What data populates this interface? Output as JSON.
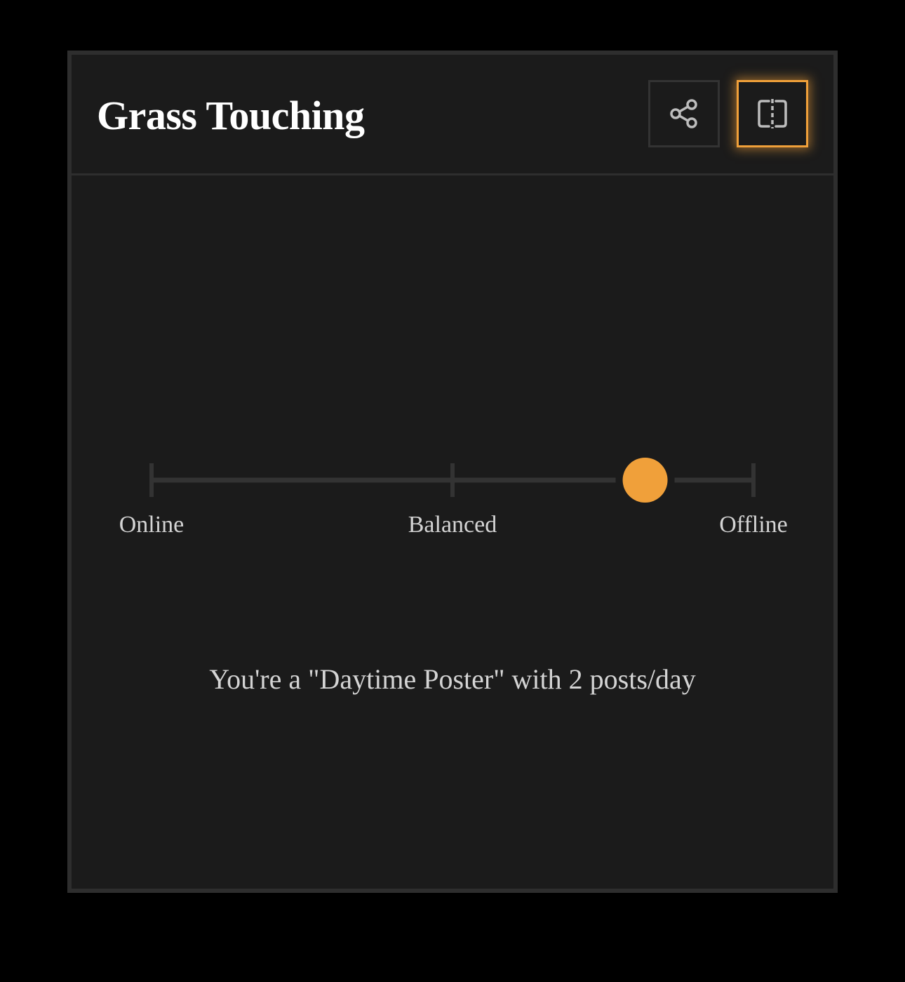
{
  "card": {
    "title": "Grass Touching",
    "actions": {
      "share_icon": "share-icon",
      "compare_icon": "split-view-icon"
    }
  },
  "scale": {
    "labels": [
      "Online",
      "Balanced",
      "Offline"
    ],
    "position": 0.82
  },
  "summary": "You're a \"Daytime Poster\" with 2 posts/day",
  "colors": {
    "accent": "#f0a03a",
    "card_bg": "#1b1b1b",
    "border": "#2e2e2e",
    "text": "#d4d4d4"
  }
}
